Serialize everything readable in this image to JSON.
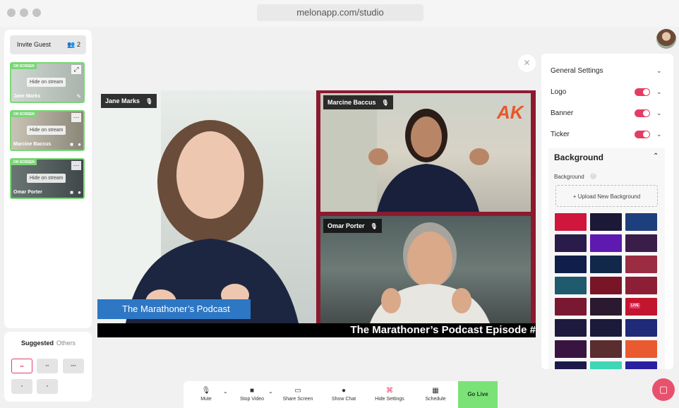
{
  "browser": {
    "url": "melonapp.com/studio"
  },
  "left_panel": {
    "invite_label": "Invite Guest",
    "guest_count": "2",
    "guests": [
      {
        "badge": "ON SCREEN",
        "hide_label": "Hide on stream",
        "name": "Jane Marks",
        "bg": "#b9c2bd"
      },
      {
        "badge": "ON SCREEN",
        "hide_label": "Hide on stream",
        "name": "Marcine Baccus",
        "bg": "#b2aea2"
      },
      {
        "badge": "ON SCREEN",
        "hide_label": "Hide on stream",
        "name": "Omar Porter",
        "bg": "#55605f"
      }
    ]
  },
  "layouts": {
    "suggested_label": "Suggested",
    "others_label": "Others"
  },
  "stage": {
    "participants": [
      "Jane Marks",
      "Marcine Baccus",
      "Omar Porter"
    ],
    "banner_text": "The Marathoner’s Podcast",
    "ticker_text": "The Marathoner’s Podcast Episode #",
    "logo_text": "AK"
  },
  "settings": {
    "general_label": "General Settings",
    "logo_label": "Logo",
    "banner_label": "Banner",
    "ticker_label": "Ticker",
    "background_title": "Background",
    "background_sublabel": "Background",
    "upload_label": "Upload New Background",
    "live_badge": "LIVE",
    "swatches": [
      "#d0163c",
      "#1c1838",
      "#1d3f7d",
      "#2a1c4a",
      "#5e1ab0",
      "#3b1d4a",
      "#0f1f4a",
      "#12284a",
      "#9b2c42",
      "#1f5a6e",
      "#7a1527",
      "#8c1f35",
      "#7a1831",
      "#2b1a2f",
      "#c2162f",
      "#1d1a3e",
      "#1b1a3a",
      "#1f2a78",
      "#3a1440",
      "#5a2d2e",
      "#ea5a30",
      "#1b1a4a",
      "#3ed6b5",
      "#2a1fa0"
    ]
  },
  "toolbar": {
    "mute": "Mute",
    "stop_video": "Stop Video",
    "share_screen": "Share Screen",
    "show_chat": "Show Chat",
    "hide_settings": "Hide Settings",
    "schedule": "Schedule",
    "go_live": "Go Live"
  },
  "colors": {
    "accent": "#e53c63",
    "live_green": "#7be277",
    "stage_border": "#8b1a2f",
    "banner_blue": "#2d77c4"
  }
}
